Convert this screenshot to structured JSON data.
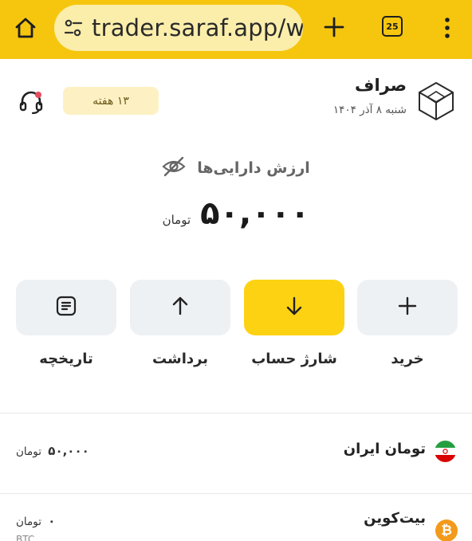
{
  "browser": {
    "url": "trader.saraf.app/w",
    "tab_count": "25"
  },
  "header": {
    "brand": "صراف",
    "date": "شنبه ۸ آذر ۱۴۰۴",
    "weeks_badge": "۱۳ هفته"
  },
  "balance": {
    "label": "ارزش دارایی‌ها",
    "amount": "۵۰,۰۰۰",
    "currency": "تومان"
  },
  "actions": [
    {
      "label": "خرید",
      "icon": "plus-icon"
    },
    {
      "label": "شارژ حساب",
      "icon": "arrow-down-icon"
    },
    {
      "label": "برداشت",
      "icon": "arrow-up-icon"
    },
    {
      "label": "تاریخچه",
      "icon": "history-icon"
    }
  ],
  "assets": [
    {
      "name": "تومان ایران",
      "amount": "۵۰,۰۰۰",
      "unit": "تومان",
      "icon": "iran-flag-icon"
    },
    {
      "name": "بیت‌کوین",
      "amount": "۰",
      "unit": "تومان",
      "sub": "BTC",
      "icon": "bitcoin-icon"
    }
  ],
  "colors": {
    "browser_bar": "#f6c60f",
    "primary_action": "#fcd213",
    "action_bg": "#eef1f4",
    "badge_bg": "#fdf1c4",
    "bitcoin": "#f29a1b"
  }
}
